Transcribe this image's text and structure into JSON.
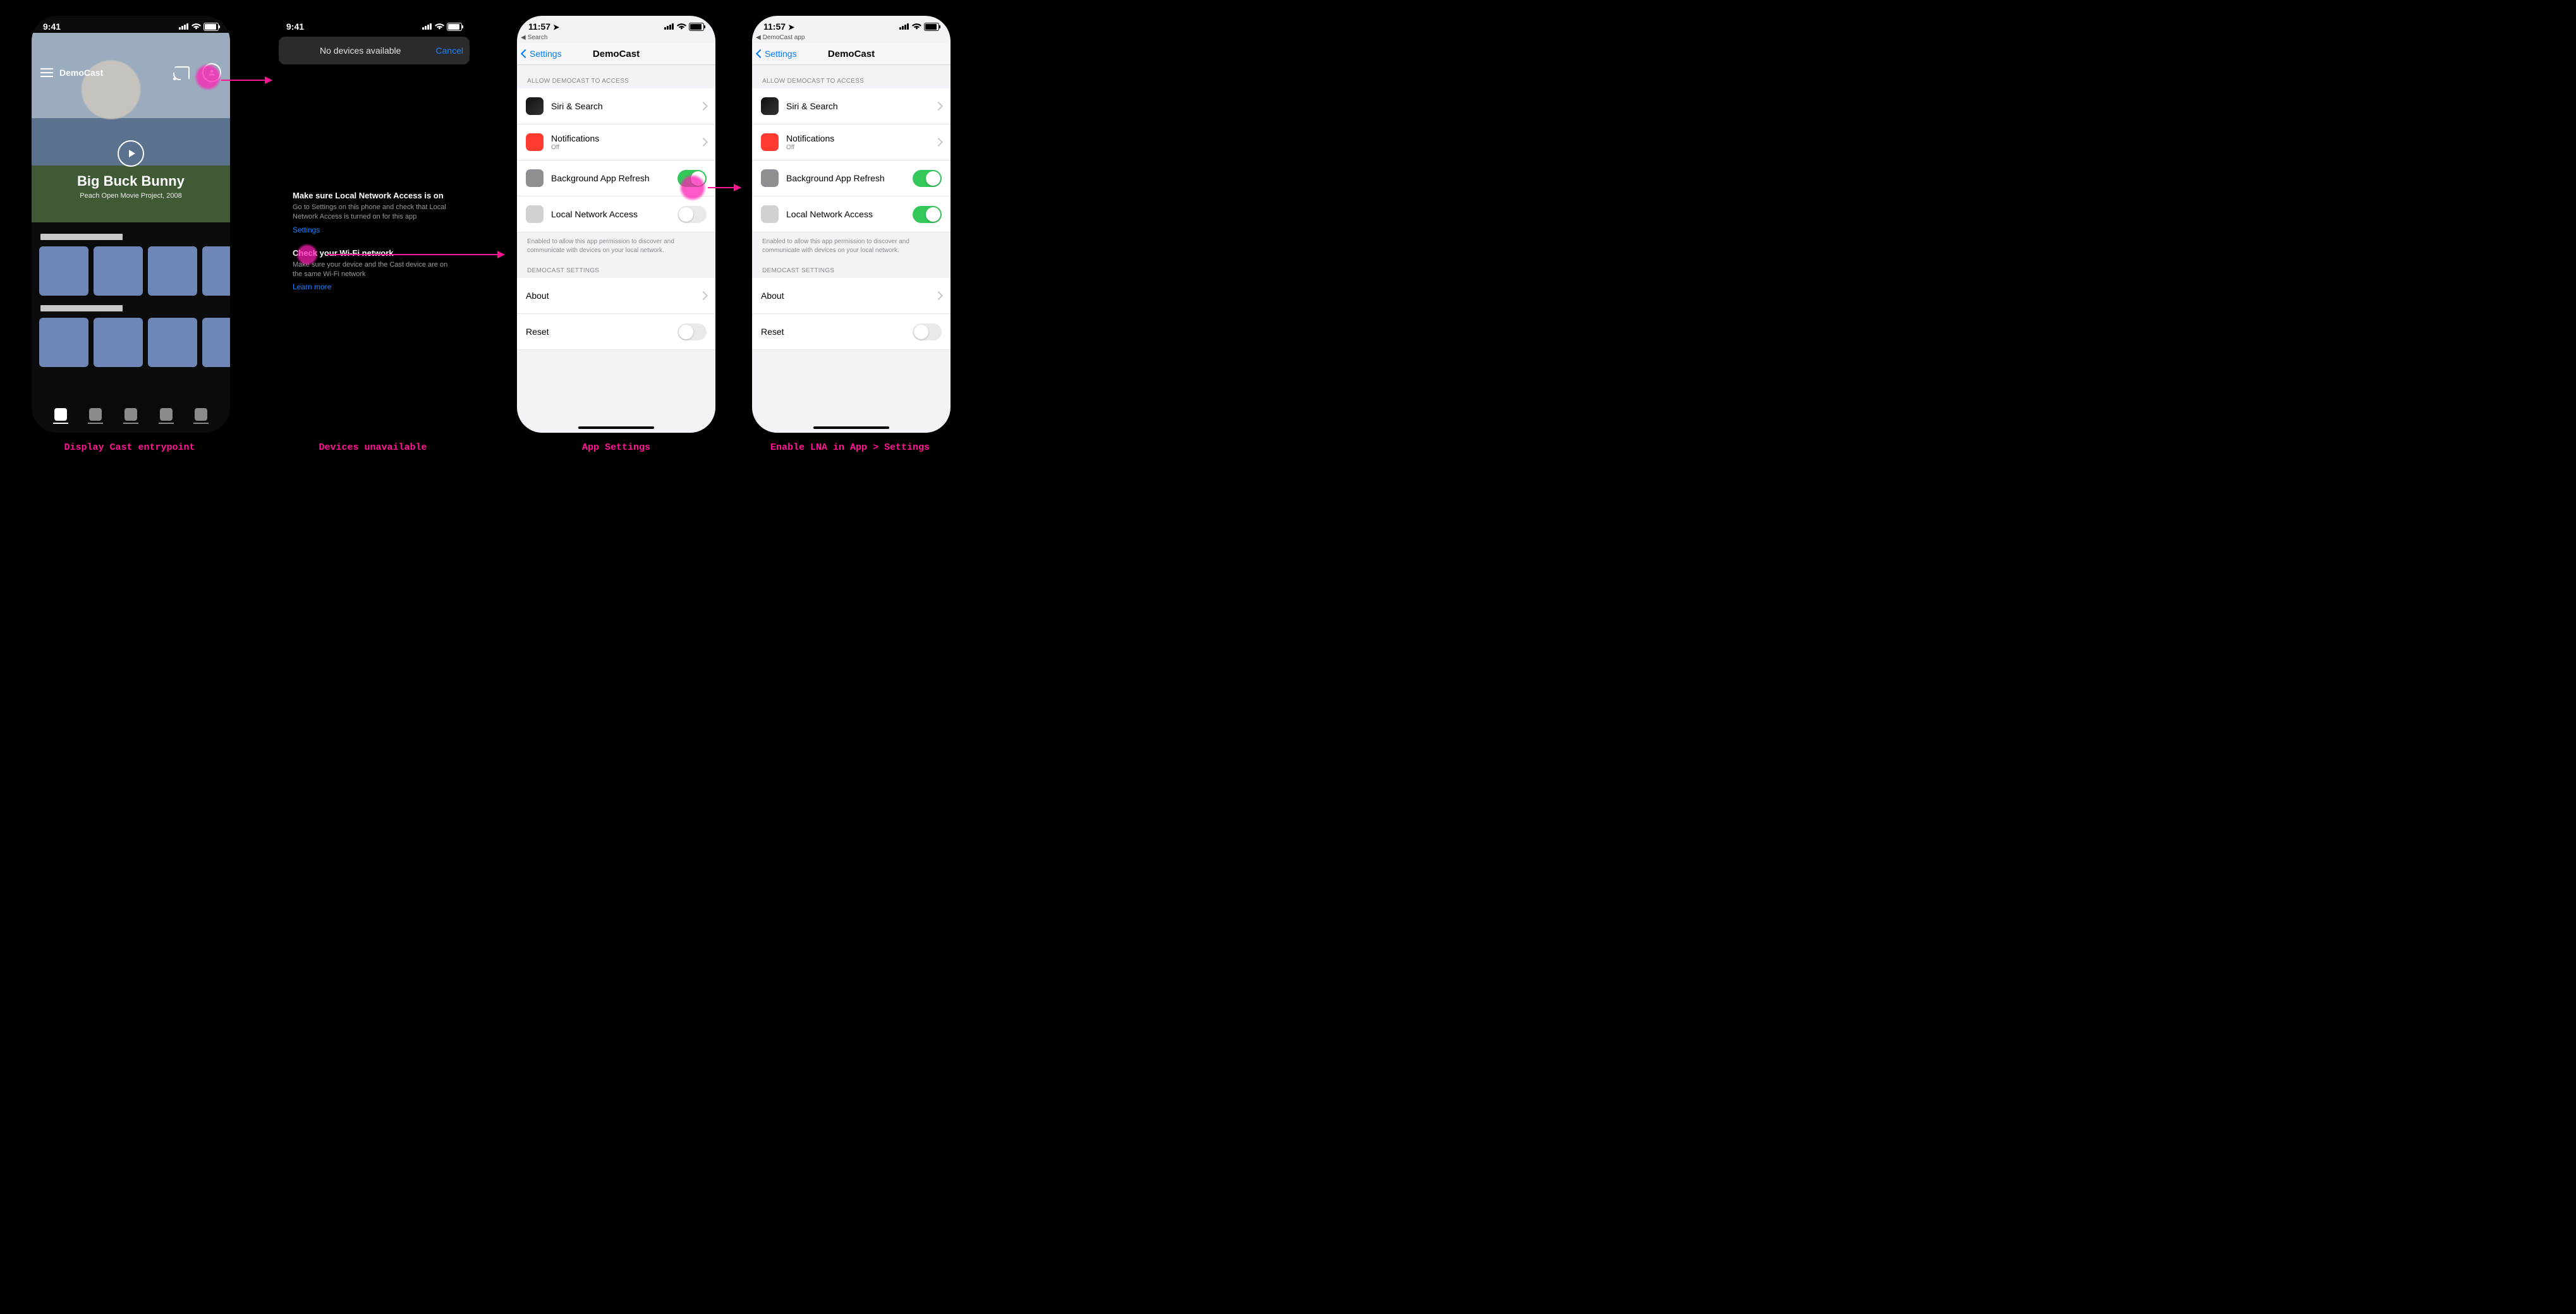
{
  "status": {
    "time_12h": "9:41",
    "time_24h": "11:57"
  },
  "screen1": {
    "app_name": "DemoCast",
    "hero_title": "Big Buck Bunny",
    "hero_subtitle": "Peach Open Movie Project, 2008"
  },
  "screen2": {
    "sheet_title": "No devices available",
    "cancel": "Cancel",
    "tip1_title": "Make sure Local Network Access is on",
    "tip1_body": "Go to Settings on this phone and check that Local Network Access is turned on for this app",
    "settings_link": "Settings",
    "tip2_title": "Check your Wi-Fi network",
    "tip2_body": "Make sure your device and the Cast device are on the same Wi-Fi network",
    "learn_more": "Learn more"
  },
  "settings": {
    "breadcrumb_search": "Search",
    "breadcrumb_app": "DemoCast app",
    "back": "Settings",
    "page_title": "DemoCast",
    "section_allow": "ALLOW DEMOCAST TO ACCESS",
    "siri": "Siri & Search",
    "notifications": "Notifications",
    "notifications_sub": "Off",
    "bg_refresh": "Background App Refresh",
    "lna": "Local Network Access",
    "lna_footnote": "Enabled to allow this app permission to discover and communicate with devices on your local network.",
    "section_app": "DEMOCAST SETTINGS",
    "about": "About",
    "reset": "Reset"
  },
  "captions": {
    "c1": "Display Cast entrypoint",
    "c2": "Devices unavailable",
    "c3": "App Settings",
    "c4": "Enable LNA in App > Settings"
  }
}
